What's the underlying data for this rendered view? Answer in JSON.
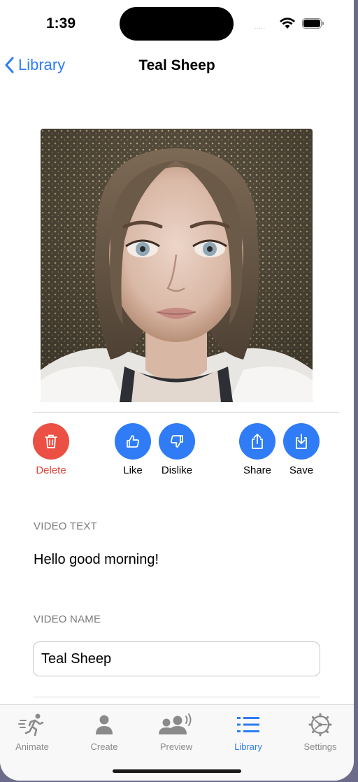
{
  "status_bar": {
    "time": "1:39",
    "signal": "....."
  },
  "nav": {
    "back_label": "Library",
    "title": "Teal Sheep"
  },
  "actions": {
    "delete": "Delete",
    "like": "Like",
    "dislike": "Dislike",
    "share": "Share",
    "save": "Save"
  },
  "video_text": {
    "caption": "VIDEO TEXT",
    "value": "Hello good morning!"
  },
  "video_name": {
    "caption": "VIDEO NAME",
    "value": "Teal Sheep"
  },
  "tabs": [
    {
      "label": "Animate",
      "icon": "running-figure-icon"
    },
    {
      "label": "Create",
      "icon": "person-icon"
    },
    {
      "label": "Preview",
      "icon": "people-speaking-icon"
    },
    {
      "label": "Library",
      "icon": "list-icon"
    },
    {
      "label": "Settings",
      "icon": "gear-icon"
    }
  ],
  "active_tab": "Library",
  "colors": {
    "accent": "#2f7cf6",
    "destructive": "#ec4f43"
  }
}
